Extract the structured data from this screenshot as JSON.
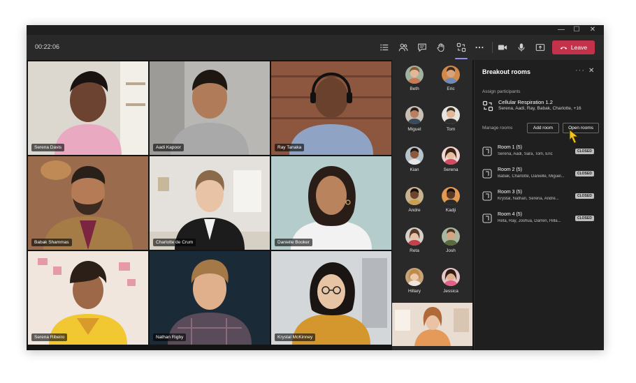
{
  "window_controls": {
    "minimize": "—",
    "maximize": "☐",
    "close": "✕"
  },
  "toolbar": {
    "timer": "00:22:06",
    "buttons": [
      "list-icon",
      "people-icon",
      "chat-icon",
      "raise-hand-icon",
      "breakout-rooms-icon",
      "more-icon",
      "camera-icon",
      "microphone-icon",
      "share-screen-icon"
    ],
    "leave_label": "Leave",
    "leave_color": "#c4314b",
    "accent_color": "#8f8ff0"
  },
  "video_tiles": [
    {
      "name": "Serena Davis"
    },
    {
      "name": "Aadi Kapoor"
    },
    {
      "name": "Ray Tanaka"
    },
    {
      "name": "Babak Shammas"
    },
    {
      "name": "Charlotte de Crum"
    },
    {
      "name": "Danielle Booker"
    },
    {
      "name": "Serena Ribeiro"
    },
    {
      "name": "Nathan Rigby"
    },
    {
      "name": "Krystal McKinney"
    }
  ],
  "roster": [
    "Beth",
    "Eric",
    "Miguel",
    "Tom",
    "Kian",
    "Serena",
    "Andre",
    "Kadji",
    "Reta",
    "Josh",
    "Hillary",
    "Jessica"
  ],
  "panel": {
    "title": "Breakout rooms",
    "more": "···",
    "close": "✕",
    "assign_label": "Assign participants",
    "assign_title": "Cellular Respiration 1.2",
    "assign_sub": "Serena, Aadi, Ray, Babak, Charlotte, +16",
    "manage_label": "Manage rooms",
    "add_room": "Add room",
    "open_rooms": "Open rooms",
    "rooms": [
      {
        "name": "Room 1 (5)",
        "members": "Serena, Aadi, Sara, Tom, Eric",
        "status": "CLOSED"
      },
      {
        "name": "Room 2 (5)",
        "members": "Babak, Charlotte, Danielle, Miguel...",
        "status": "CLOSED"
      },
      {
        "name": "Room 3 (5)",
        "members": "Krystal, Nathan, Serena, Andre...",
        "status": "CLOSED"
      },
      {
        "name": "Room 4 (5)",
        "members": "Reta, Ray, Joshua, Darren, Hilla...",
        "status": "CLOSED"
      }
    ]
  }
}
